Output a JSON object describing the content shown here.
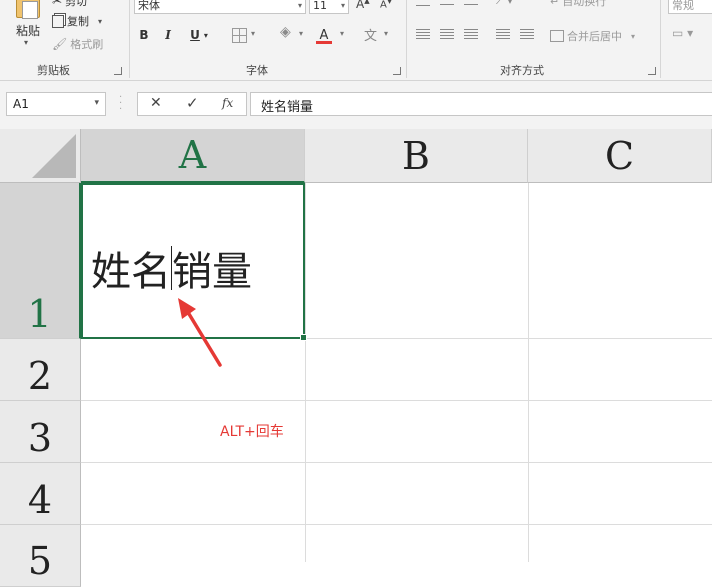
{
  "ribbon": {
    "clipboard": {
      "paste_label": "粘贴",
      "cut_label": "剪切",
      "copy_label": "复制",
      "format_painter_label": "格式刷",
      "group_label": "剪贴板"
    },
    "font": {
      "font_name": "宋体",
      "font_size": "11",
      "bold": "B",
      "italic": "I",
      "underline": "U",
      "font_color_glyph": "A",
      "group_label": "字体"
    },
    "alignment": {
      "wrap_text_label": "自动换行",
      "merge_center_label": "合并后居中",
      "group_label": "对齐方式"
    },
    "number": {
      "format_label": "常规"
    }
  },
  "formula_bar": {
    "name_box": "A1",
    "fx_label": "fx",
    "content": "姓名销量"
  },
  "sheet": {
    "columns": [
      "A",
      "B",
      "C"
    ],
    "rows": [
      "1",
      "2",
      "3",
      "4",
      "5"
    ],
    "cell_a1": {
      "before_cursor": "姓名",
      "after_cursor": "销量"
    },
    "annotation": "ALT+回车"
  },
  "colors": {
    "accent": "#217346",
    "annotation": "#e53935"
  }
}
